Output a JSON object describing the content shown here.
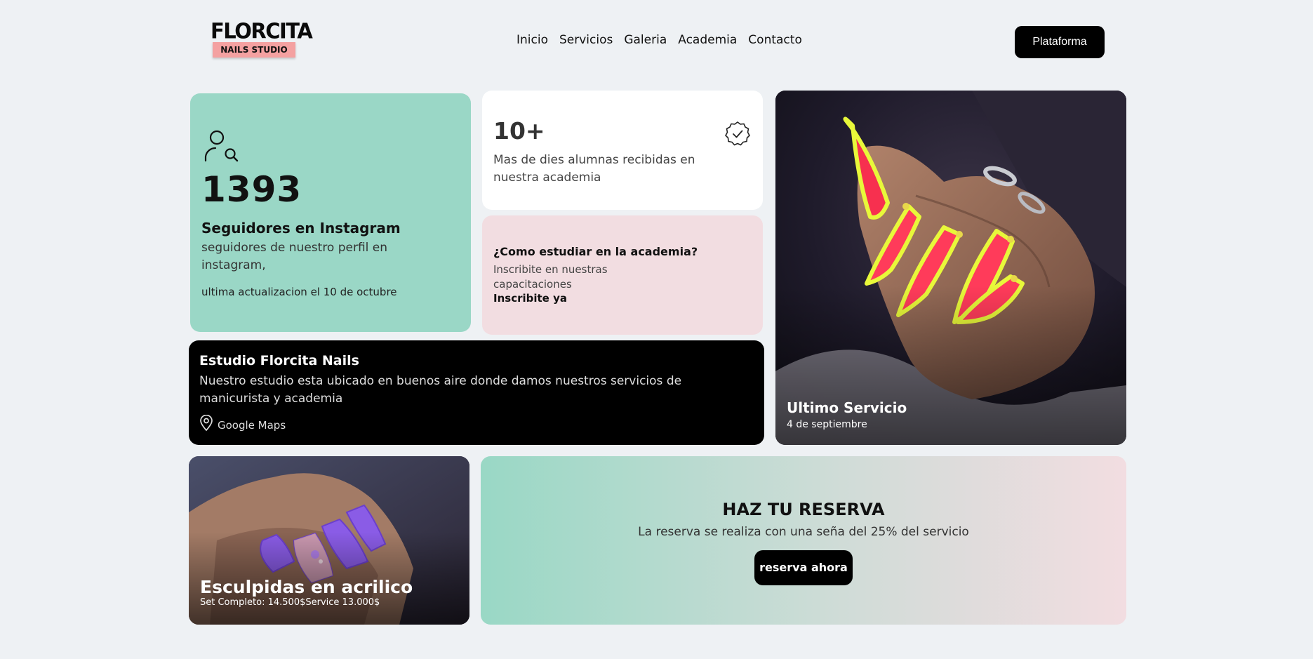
{
  "header": {
    "logo_top": "FLORCITA",
    "logo_bottom": "NAILS STUDIO",
    "nav": [
      "Inicio",
      "Servicios",
      "Galeria",
      "Academia",
      "Contacto"
    ],
    "platform_button": "Plataforma"
  },
  "instagram": {
    "icon": "user-search-icon",
    "count": "1393",
    "title": "Seguidores en Instagram",
    "description": "seguidores de nuestro perfil en instagram,",
    "updated": "ultima actualizacion el 10 de octubre"
  },
  "alumnas": {
    "number": "10+",
    "description": "Mas de dies alumnas recibidas en nuestra academia",
    "icon": "verified-badge-icon"
  },
  "academia": {
    "title": "¿Como estudiar en la academia?",
    "description": "Inscribite en nuestras capacitaciones",
    "link": "Inscribite ya"
  },
  "ultimo_servicio": {
    "title": "Ultimo Servicio",
    "date": "4 de septiembre"
  },
  "estudio": {
    "title": "Estudio Florcita Nails",
    "description": "Nuestro estudio esta ubicado en buenos aire donde damos nuestros servicios de manicurista y academia",
    "map_icon": "map-pin-icon",
    "map_link": "Google Maps"
  },
  "acrilico": {
    "title": "Esculpidas en acrilico",
    "prices": "Set Completo: 14.500$Service 13.000$"
  },
  "reserva": {
    "title": "HAZ TU RESERVA",
    "subtitle": "La reserva se realiza con una seña del 25% del servicio",
    "button": "reserva ahora"
  },
  "colors": {
    "mint": "#9ad7c6",
    "pink": "#f2dde1",
    "logo_pink": "#f4a1a1",
    "black": "#000000"
  }
}
